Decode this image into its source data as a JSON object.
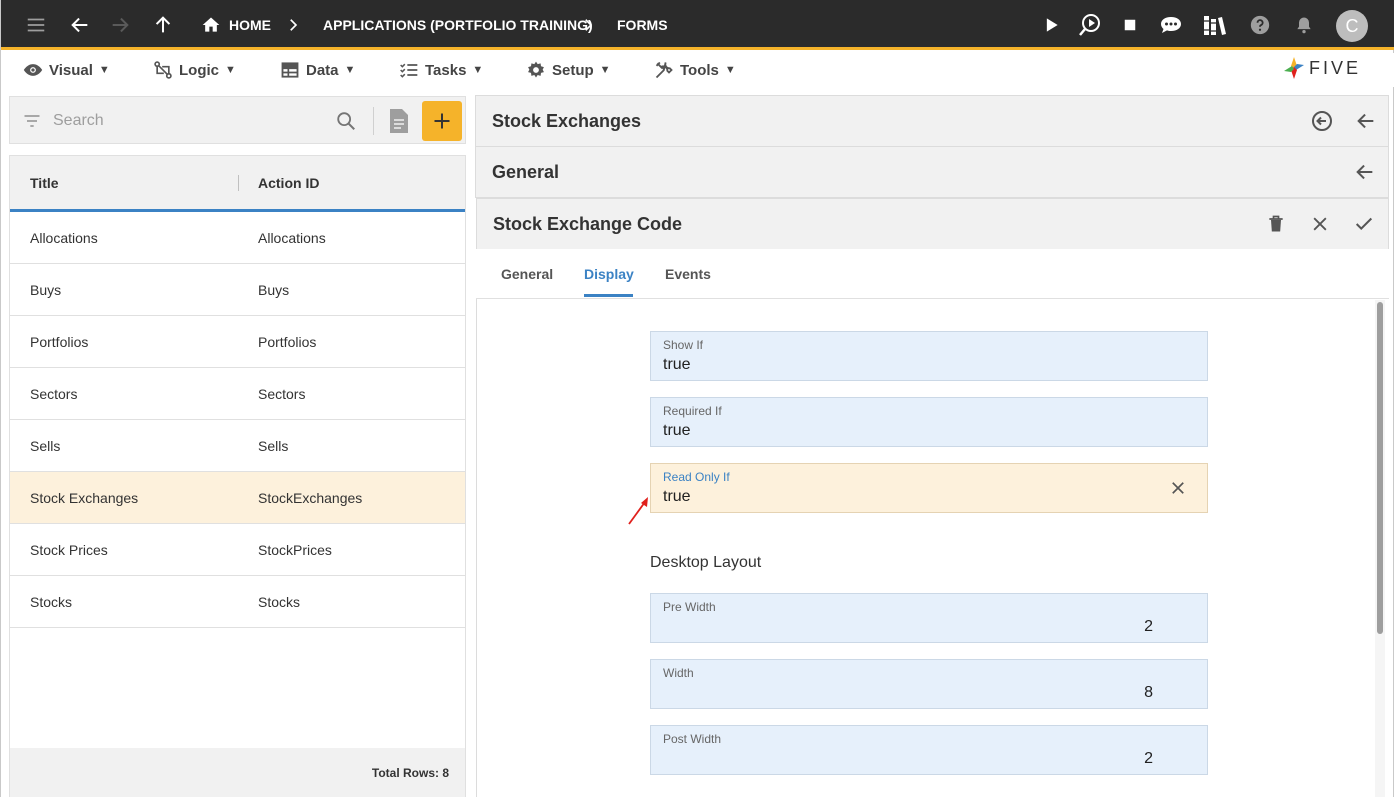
{
  "topbar": {
    "breadcrumbs": [
      "HOME",
      "APPLICATIONS (PORTFOLIO TRAINING)",
      "FORMS"
    ],
    "avatar_initial": "C"
  },
  "menu": {
    "items": [
      "Visual",
      "Logic",
      "Data",
      "Tasks",
      "Setup",
      "Tools"
    ],
    "caret": "▼"
  },
  "logo": {
    "text": "FIVE"
  },
  "search": {
    "placeholder": "Search"
  },
  "list": {
    "columns": [
      "Title",
      "Action ID"
    ],
    "rows": [
      {
        "title": "Allocations",
        "action_id": "Allocations"
      },
      {
        "title": "Buys",
        "action_id": "Buys"
      },
      {
        "title": "Portfolios",
        "action_id": "Portfolios"
      },
      {
        "title": "Sectors",
        "action_id": "Sectors"
      },
      {
        "title": "Sells",
        "action_id": "Sells"
      },
      {
        "title": "Stock Exchanges",
        "action_id": "StockExchanges"
      },
      {
        "title": "Stock Prices",
        "action_id": "StockPrices"
      },
      {
        "title": "Stocks",
        "action_id": "Stocks"
      }
    ],
    "selected_index": 5,
    "footer": "Total Rows: 8"
  },
  "panels": {
    "form_title": "Stock Exchanges",
    "page_title": "General",
    "field_title": "Stock Exchange Code"
  },
  "tabs": {
    "items": [
      "General",
      "Display",
      "Events"
    ],
    "active": "Display"
  },
  "form": {
    "show_if": {
      "label": "Show If",
      "value": "true"
    },
    "required_if": {
      "label": "Required If",
      "value": "true"
    },
    "read_only_if": {
      "label": "Read Only If",
      "value": "true"
    },
    "desktop_layout_heading": "Desktop Layout",
    "pre_width": {
      "label": "Pre Width",
      "value": "2"
    },
    "width": {
      "label": "Width",
      "value": "8"
    },
    "post_width": {
      "label": "Post Width",
      "value": "2"
    }
  },
  "colors": {
    "accent": "#f5b32a",
    "topbar": "#2b2b2b",
    "link": "#3b82c4",
    "selected_row": "#fdf1dc",
    "field_bg": "#e6f0fb",
    "annotation_arrow": "#e0201c"
  }
}
